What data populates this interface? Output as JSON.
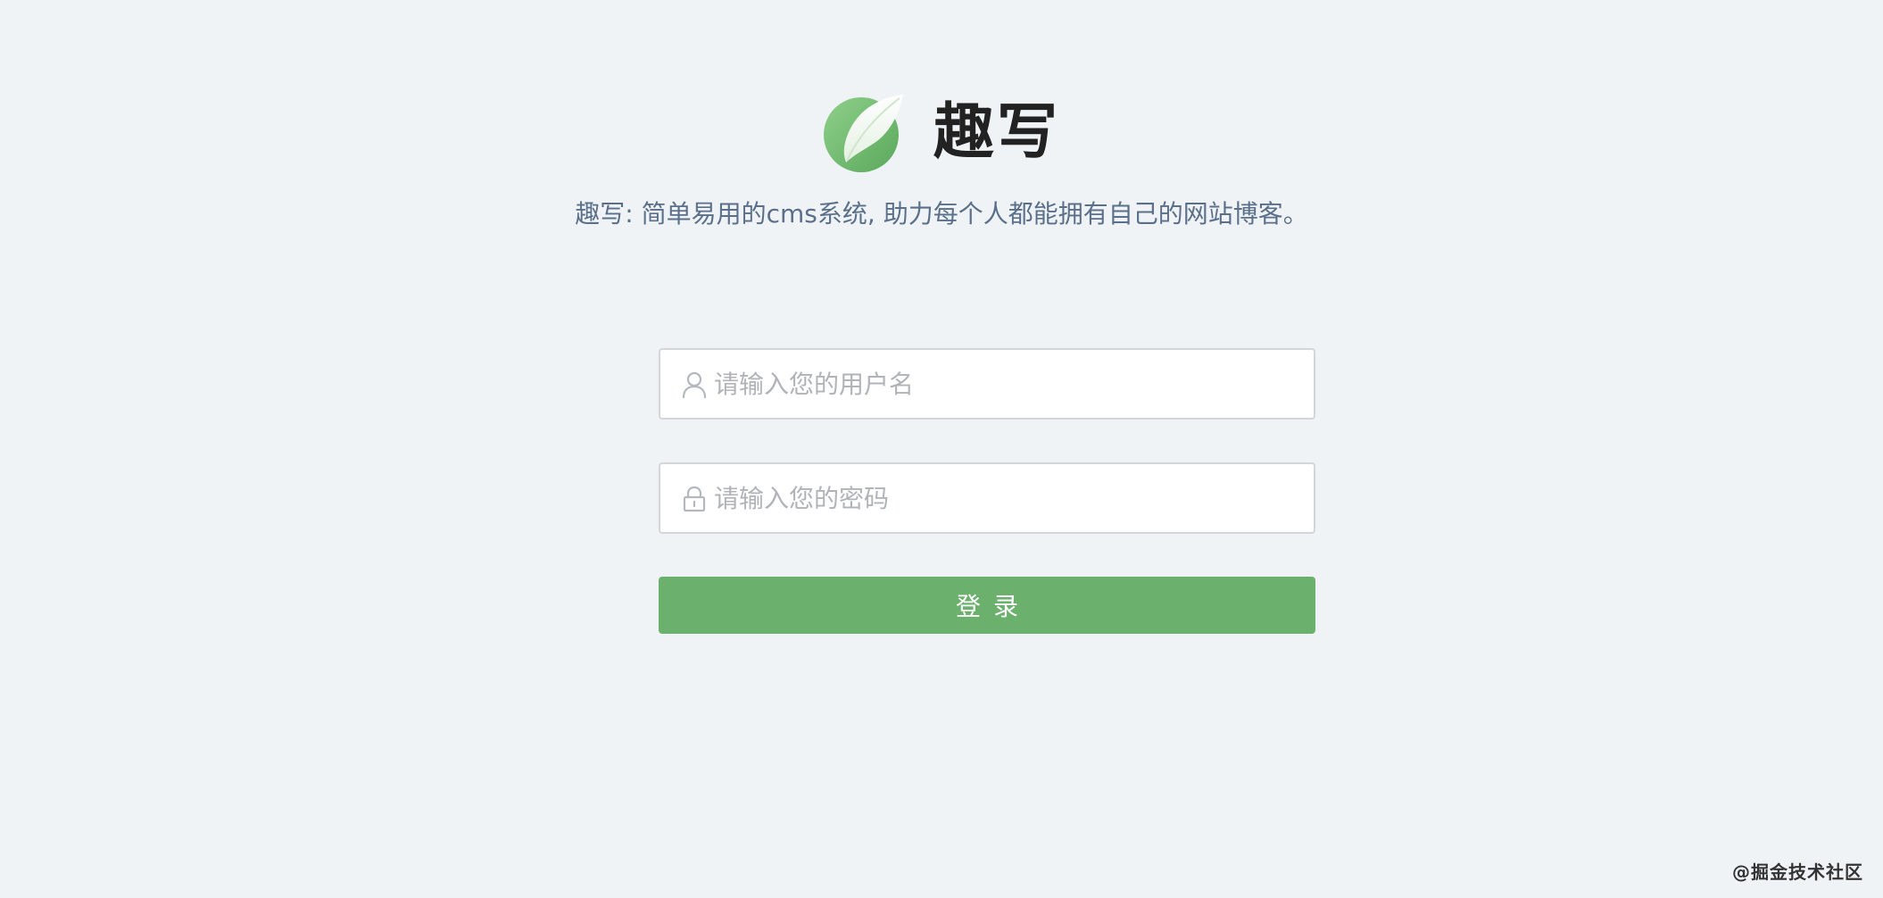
{
  "brand": {
    "title": "趣写",
    "logo_icon": "quill-feather-icon",
    "tagline": "趣写: 简单易用的cms系统, 助力每个人都能拥有自己的网站博客。"
  },
  "login_form": {
    "username": {
      "icon": "user-icon",
      "value": "",
      "placeholder": "请输入您的用户名"
    },
    "password": {
      "icon": "lock-icon",
      "value": "",
      "placeholder": "请输入您的密码"
    },
    "submit_label": "登录"
  },
  "watermark": "@掘金技术社区",
  "colors": {
    "background": "#f0f3f6",
    "accent": "#6bb16d",
    "tagline": "#5a6f8a"
  }
}
